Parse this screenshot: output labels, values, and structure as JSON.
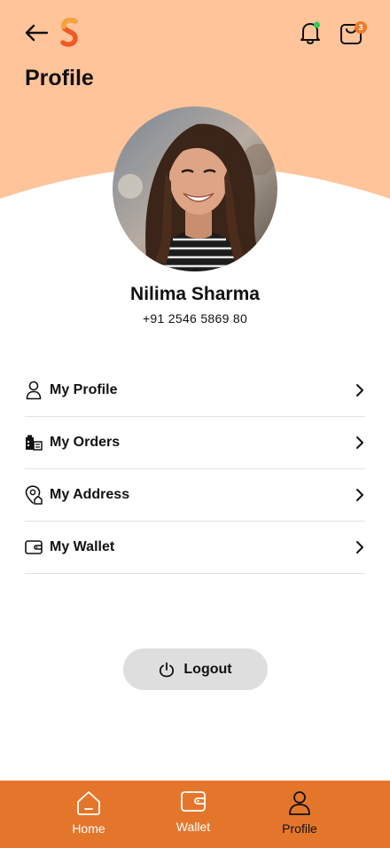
{
  "header": {
    "title": "Profile",
    "cart_count": "3",
    "bg_color": "#ffc49a"
  },
  "user": {
    "name": "Nilima Sharma",
    "phone": "+91 2546 5869 80"
  },
  "menu": {
    "items": [
      {
        "label": "My Profile",
        "icon": "user-icon"
      },
      {
        "label": "My Orders",
        "icon": "orders-icon"
      },
      {
        "label": "My Address",
        "icon": "location-icon"
      },
      {
        "label": "My Wallet",
        "icon": "wallet-icon"
      }
    ]
  },
  "logout": {
    "label": "Logout"
  },
  "nav": {
    "items": [
      {
        "label": "Home",
        "icon": "home-icon"
      },
      {
        "label": "Wallet",
        "icon": "wallet-icon"
      },
      {
        "label": "Profile",
        "icon": "user-icon",
        "active": true
      }
    ],
    "color": "#e4762c"
  }
}
